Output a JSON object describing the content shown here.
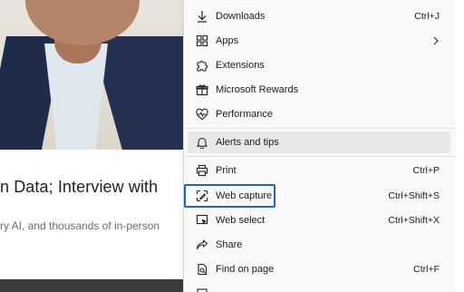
{
  "article": {
    "title": "n Data; Interview with",
    "subtitle": "ry AI, and thousands of in-person"
  },
  "menu": {
    "items": [
      {
        "label": "Downloads",
        "shortcut": "Ctrl+J",
        "icon": "download-icon"
      },
      {
        "label": "Apps",
        "shortcut": "",
        "icon": "apps-icon",
        "has_submenu": true
      },
      {
        "label": "Extensions",
        "shortcut": "",
        "icon": "extensions-icon"
      },
      {
        "label": "Microsoft Rewards",
        "shortcut": "",
        "icon": "rewards-icon"
      },
      {
        "label": "Performance",
        "shortcut": "",
        "icon": "performance-icon"
      },
      {
        "label": "Alerts and tips",
        "shortcut": "",
        "icon": "bell-icon",
        "hovered": true
      },
      {
        "label": "Print",
        "shortcut": "Ctrl+P",
        "icon": "print-icon"
      },
      {
        "label": "Web capture",
        "shortcut": "Ctrl+Shift+S",
        "icon": "web-capture-icon",
        "highlighted": true
      },
      {
        "label": "Web select",
        "shortcut": "Ctrl+Shift+X",
        "icon": "web-select-icon"
      },
      {
        "label": "Share",
        "shortcut": "",
        "icon": "share-icon"
      },
      {
        "label": "Find on page",
        "shortcut": "Ctrl+F",
        "icon": "find-icon"
      }
    ]
  },
  "colors": {
    "highlight_border": "#1f5fd6",
    "menu_background": "#f9f9f9",
    "hover_background": "#e8e8e8"
  }
}
